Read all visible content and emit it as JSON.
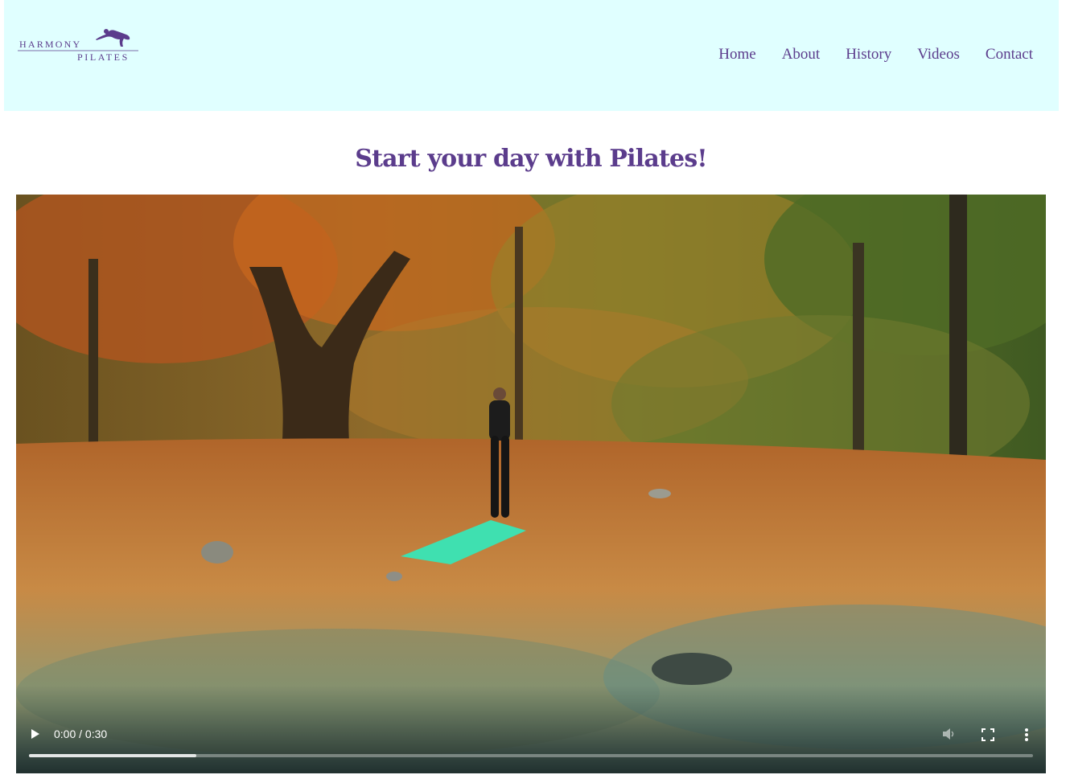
{
  "brand": {
    "logo_line1": "HARMONY",
    "logo_line2": "PILATES",
    "color": "#5b3c8c"
  },
  "nav": {
    "items": [
      "Home",
      "About",
      "History",
      "Videos",
      "Contact"
    ]
  },
  "hero": {
    "headline": "Start your day with Pilates!"
  },
  "video": {
    "time": "0:00 / 0:30",
    "buffered_fraction": 0.167,
    "icons": [
      "play-icon",
      "volume-icon",
      "fullscreen-icon",
      "more-vert-icon"
    ]
  },
  "colors": {
    "header_bg": "#e0ffff",
    "accent": "#5b3c8c",
    "mat": "#3fe0b0"
  }
}
